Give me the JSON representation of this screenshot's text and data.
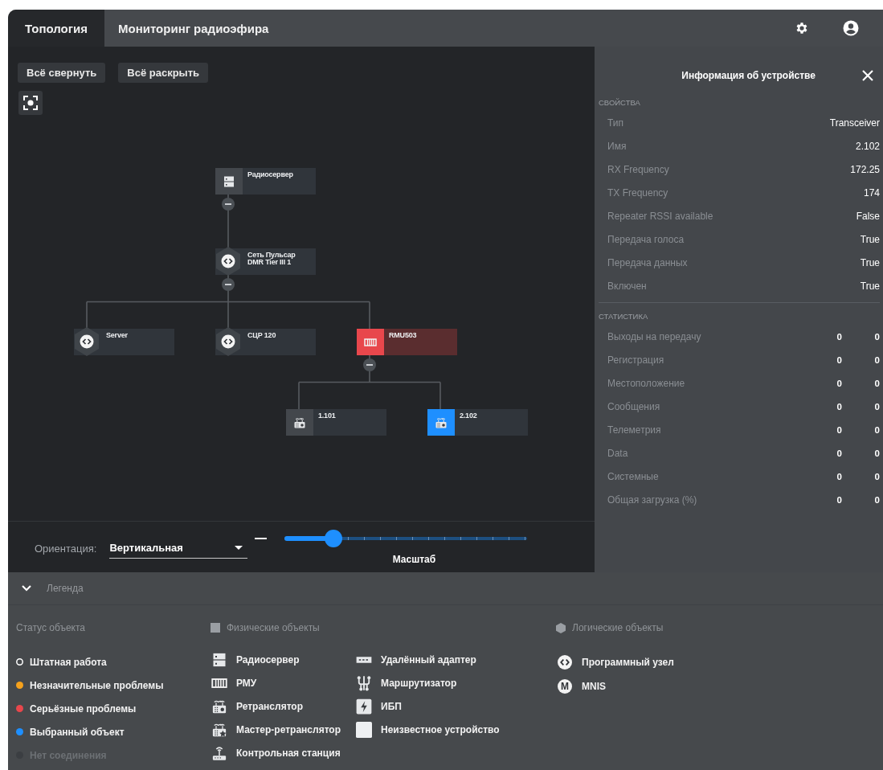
{
  "tabs": [
    {
      "label": "Топология",
      "selected": true
    },
    {
      "label": "Мониторинг радиоэфира",
      "selected": false
    }
  ],
  "toolbar": {
    "buttons": [
      "Всё свернуть",
      "Всё раскрыть"
    ]
  },
  "topology": {
    "label": "Радиосервер",
    "kind": "server",
    "serious": false,
    "selected": false,
    "expanded": true,
    "children": [
      {
        "label": "Сеть Пульсар\nDMR Tier III 1",
        "kind": "logical",
        "serious": false,
        "selected": false,
        "expanded": true,
        "children": [
          {
            "label": "Server",
            "kind": "logical",
            "serious": false,
            "selected": false
          },
          {
            "label": "СЦР 120",
            "kind": "logical",
            "serious": false,
            "selected": false
          },
          {
            "label": "RMU503",
            "kind": "rmu",
            "serious": true,
            "selected": false,
            "expanded": true,
            "children": [
              {
                "label": "1.101",
                "kind": "repeater",
                "serious": false,
                "selected": false
              },
              {
                "label": "2.102",
                "kind": "repeater",
                "serious": false,
                "selected": true
              }
            ]
          }
        ]
      }
    ]
  },
  "bottom_bar": {
    "orientation": {
      "label": "Ориентация:",
      "value": "Вертикальная"
    },
    "zoom": {
      "label": "Масштаб",
      "level": 0.2
    }
  },
  "device_panel": {
    "title": "Информация об устройстве",
    "sections": [
      {
        "title": "СВОЙСТВА",
        "kind": "properties",
        "rows": [
          {
            "label": "Тип",
            "values": [
              "Transceiver"
            ]
          },
          {
            "label": "Имя",
            "values": [
              "2.102"
            ]
          },
          {
            "label": "RX Frequency",
            "values": [
              "172.25"
            ]
          },
          {
            "label": "TX Frequency",
            "values": [
              "174"
            ]
          },
          {
            "label": "Repeater RSSI available",
            "values": [
              "False"
            ]
          },
          {
            "label": "Передача голоса",
            "values": [
              "True"
            ]
          },
          {
            "label": "Передача данных",
            "values": [
              "True"
            ]
          },
          {
            "label": "Включен",
            "values": [
              "True"
            ]
          }
        ]
      },
      {
        "title": "СТАТИСТИКА",
        "kind": "statistics",
        "rows": [
          {
            "label": "Выходы на передачу",
            "values": [
              "0",
              "0"
            ]
          },
          {
            "label": "Регистрация",
            "values": [
              "0",
              "0"
            ]
          },
          {
            "label": "Местоположение",
            "values": [
              "0",
              "0"
            ]
          },
          {
            "label": "Сообщения",
            "values": [
              "0",
              "0"
            ]
          },
          {
            "label": "Телеметрия",
            "values": [
              "0",
              "0"
            ]
          },
          {
            "label": "Data",
            "values": [
              "0",
              "0"
            ]
          },
          {
            "label": "Системные",
            "values": [
              "0",
              "0"
            ]
          },
          {
            "label": "Общая загрузка (%)",
            "values": [
              "0",
              "0"
            ]
          }
        ]
      }
    ]
  },
  "legend": {
    "title": "Легенда",
    "expanded": true,
    "status": {
      "title": "Статус объекта",
      "items": [
        {
          "label": "Штатная работа",
          "color": "#ffffff",
          "hollow": true,
          "disabled": false
        },
        {
          "label": "Незначительные проблемы",
          "color": "#f5a11c",
          "hollow": false,
          "disabled": false
        },
        {
          "label": "Серьёзные проблемы",
          "color": "#e8474c",
          "hollow": false,
          "disabled": false
        },
        {
          "label": "Выбранный объект",
          "color": "#1e8fff",
          "hollow": false,
          "disabled": false
        },
        {
          "label": "Нет соединения",
          "color": "#3b3e42",
          "hollow": false,
          "disabled": true
        }
      ]
    },
    "physical": {
      "title": "Физические объекты",
      "items": [
        {
          "label": "Радиосервер",
          "kind": "server"
        },
        {
          "label": "РМУ",
          "kind": "rmu"
        },
        {
          "label": "Ретранслятор",
          "kind": "repeater"
        },
        {
          "label": "Мастер-ретранслятор",
          "kind": "master"
        },
        {
          "label": "Контрольная станция",
          "kind": "station"
        },
        {
          "label": "Удалённый адаптер",
          "kind": "adapter"
        },
        {
          "label": "Маршрутизатор",
          "kind": "router"
        },
        {
          "label": "ИБП",
          "kind": "ups"
        },
        {
          "label": "Неизвестное устройство",
          "kind": "unknown"
        }
      ]
    },
    "logical": {
      "title": "Логические объекты",
      "items": [
        {
          "label": "Программный узел",
          "kind": "program"
        },
        {
          "label": "MNIS",
          "kind": "letter",
          "badge": "M"
        }
      ]
    }
  }
}
